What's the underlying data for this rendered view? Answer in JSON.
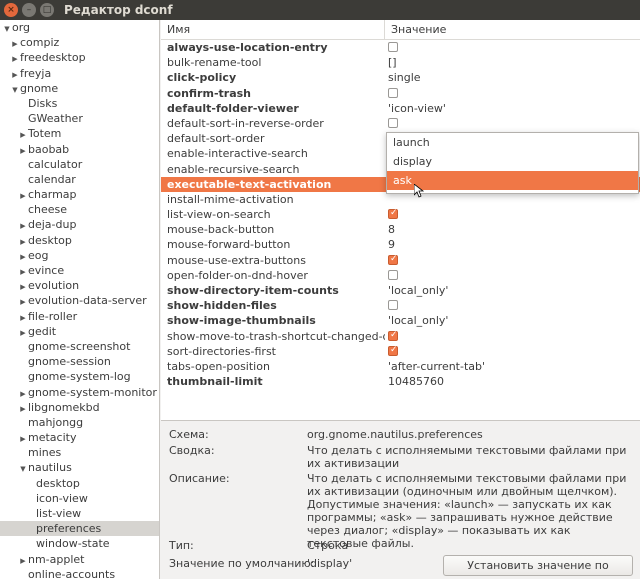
{
  "window": {
    "title": "Редактор dconf"
  },
  "sidebar": {
    "items": [
      {
        "label": "org",
        "indent": 0,
        "arrow": "down"
      },
      {
        "label": "compiz",
        "indent": 1,
        "arrow": "right"
      },
      {
        "label": "freedesktop",
        "indent": 1,
        "arrow": "right"
      },
      {
        "label": "freyja",
        "indent": 1,
        "arrow": "right"
      },
      {
        "label": "gnome",
        "indent": 1,
        "arrow": "down"
      },
      {
        "label": "Disks",
        "indent": 2,
        "arrow": ""
      },
      {
        "label": "GWeather",
        "indent": 2,
        "arrow": ""
      },
      {
        "label": "Totem",
        "indent": 2,
        "arrow": "right"
      },
      {
        "label": "baobab",
        "indent": 2,
        "arrow": "right"
      },
      {
        "label": "calculator",
        "indent": 2,
        "arrow": ""
      },
      {
        "label": "calendar",
        "indent": 2,
        "arrow": ""
      },
      {
        "label": "charmap",
        "indent": 2,
        "arrow": "right"
      },
      {
        "label": "cheese",
        "indent": 2,
        "arrow": ""
      },
      {
        "label": "deja-dup",
        "indent": 2,
        "arrow": "right"
      },
      {
        "label": "desktop",
        "indent": 2,
        "arrow": "right"
      },
      {
        "label": "eog",
        "indent": 2,
        "arrow": "right"
      },
      {
        "label": "evince",
        "indent": 2,
        "arrow": "right"
      },
      {
        "label": "evolution",
        "indent": 2,
        "arrow": "right"
      },
      {
        "label": "evolution-data-server",
        "indent": 2,
        "arrow": "right"
      },
      {
        "label": "file-roller",
        "indent": 2,
        "arrow": "right"
      },
      {
        "label": "gedit",
        "indent": 2,
        "arrow": "right"
      },
      {
        "label": "gnome-screenshot",
        "indent": 2,
        "arrow": ""
      },
      {
        "label": "gnome-session",
        "indent": 2,
        "arrow": ""
      },
      {
        "label": "gnome-system-log",
        "indent": 2,
        "arrow": ""
      },
      {
        "label": "gnome-system-monitor",
        "indent": 2,
        "arrow": "right"
      },
      {
        "label": "libgnomekbd",
        "indent": 2,
        "arrow": "right"
      },
      {
        "label": "mahjongg",
        "indent": 2,
        "arrow": ""
      },
      {
        "label": "metacity",
        "indent": 2,
        "arrow": "right"
      },
      {
        "label": "mines",
        "indent": 2,
        "arrow": ""
      },
      {
        "label": "nautilus",
        "indent": 2,
        "arrow": "down"
      },
      {
        "label": "desktop",
        "indent": 3,
        "arrow": ""
      },
      {
        "label": "icon-view",
        "indent": 3,
        "arrow": ""
      },
      {
        "label": "list-view",
        "indent": 3,
        "arrow": ""
      },
      {
        "label": "preferences",
        "indent": 3,
        "arrow": "",
        "selected": true
      },
      {
        "label": "window-state",
        "indent": 3,
        "arrow": ""
      },
      {
        "label": "nm-applet",
        "indent": 2,
        "arrow": "right"
      },
      {
        "label": "online-accounts",
        "indent": 2,
        "arrow": ""
      }
    ]
  },
  "table": {
    "headers": {
      "name": "Имя",
      "value": "Значение"
    },
    "rows": [
      {
        "name": "always-use-location-entry",
        "bold": true,
        "type": "checkbox",
        "checked": false
      },
      {
        "name": "bulk-rename-tool",
        "bold": false,
        "type": "text",
        "value": "[]"
      },
      {
        "name": "click-policy",
        "bold": true,
        "type": "text",
        "value": "single"
      },
      {
        "name": "confirm-trash",
        "bold": true,
        "type": "checkbox",
        "checked": false
      },
      {
        "name": "default-folder-viewer",
        "bold": true,
        "type": "text",
        "value": "'icon-view'"
      },
      {
        "name": "default-sort-in-reverse-order",
        "bold": false,
        "type": "checkbox",
        "checked": false
      },
      {
        "name": "default-sort-order",
        "bold": false,
        "type": "text",
        "value": ""
      },
      {
        "name": "enable-interactive-search",
        "bold": false,
        "type": "text",
        "value": ""
      },
      {
        "name": "enable-recursive-search",
        "bold": false,
        "type": "text",
        "value": ""
      },
      {
        "name": "executable-text-activation",
        "bold": true,
        "type": "text",
        "value": "",
        "selected": true
      },
      {
        "name": "install-mime-activation",
        "bold": false,
        "type": "text",
        "value": ""
      },
      {
        "name": "list-view-on-search",
        "bold": false,
        "type": "checkbox",
        "checked": true
      },
      {
        "name": "mouse-back-button",
        "bold": false,
        "type": "text",
        "value": "8"
      },
      {
        "name": "mouse-forward-button",
        "bold": false,
        "type": "text",
        "value": "9"
      },
      {
        "name": "mouse-use-extra-buttons",
        "bold": false,
        "type": "checkbox",
        "checked": true
      },
      {
        "name": "open-folder-on-dnd-hover",
        "bold": false,
        "type": "checkbox",
        "checked": false
      },
      {
        "name": "show-directory-item-counts",
        "bold": true,
        "type": "text",
        "value": "'local_only'"
      },
      {
        "name": "show-hidden-files",
        "bold": true,
        "type": "checkbox",
        "checked": false
      },
      {
        "name": "show-image-thumbnails",
        "bold": true,
        "type": "text",
        "value": "'local_only'"
      },
      {
        "name": "show-move-to-trash-shortcut-changed-dialog",
        "bold": false,
        "type": "checkbox",
        "checked": true
      },
      {
        "name": "sort-directories-first",
        "bold": false,
        "type": "checkbox",
        "checked": true
      },
      {
        "name": "tabs-open-position",
        "bold": false,
        "type": "text",
        "value": "'after-current-tab'"
      },
      {
        "name": "thumbnail-limit",
        "bold": true,
        "type": "text",
        "value": "10485760"
      }
    ]
  },
  "dropdown": {
    "options": [
      "launch",
      "display",
      "ask"
    ],
    "highlighted": 2
  },
  "details": {
    "schema_label": "Схема:",
    "schema_value": "org.gnome.nautilus.preferences",
    "summary_label": "Сводка:",
    "summary_value": "Что делать с исполняемыми текстовыми файлами при их активизации",
    "description_label": "Описание:",
    "description_value": "Что делать с исполняемыми текстовыми файлами при их активизации (одиночным или двойным щелчком). Допустимые значения: «launch» — запускать их как программы; «ask» — запрашивать нужное действие через диалог; «display» — показывать их как текстовые файлы.",
    "type_label": "Тип:",
    "type_value": "Строка",
    "default_label": "Значение по умолчанию:",
    "default_value": "'display'",
    "reset_button": "Установить значение по умолчанию"
  },
  "colors": {
    "accent": "#f07746",
    "titlebar": "#3c3b37",
    "close": "#e4683c"
  }
}
